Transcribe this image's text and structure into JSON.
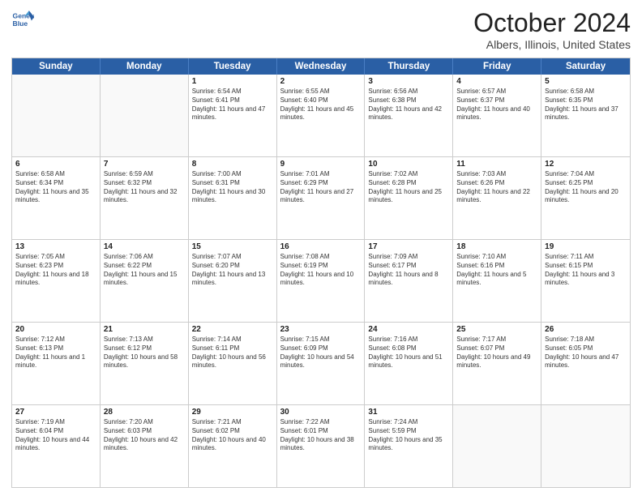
{
  "header": {
    "logo_line1": "General",
    "logo_line2": "Blue",
    "title": "October 2024",
    "subtitle": "Albers, Illinois, United States"
  },
  "days_of_week": [
    "Sunday",
    "Monday",
    "Tuesday",
    "Wednesday",
    "Thursday",
    "Friday",
    "Saturday"
  ],
  "weeks": [
    [
      {
        "day": "",
        "sunrise": "",
        "sunset": "",
        "daylight": "",
        "empty": true
      },
      {
        "day": "",
        "sunrise": "",
        "sunset": "",
        "daylight": "",
        "empty": true
      },
      {
        "day": "1",
        "sunrise": "Sunrise: 6:54 AM",
        "sunset": "Sunset: 6:41 PM",
        "daylight": "Daylight: 11 hours and 47 minutes.",
        "empty": false
      },
      {
        "day": "2",
        "sunrise": "Sunrise: 6:55 AM",
        "sunset": "Sunset: 6:40 PM",
        "daylight": "Daylight: 11 hours and 45 minutes.",
        "empty": false
      },
      {
        "day": "3",
        "sunrise": "Sunrise: 6:56 AM",
        "sunset": "Sunset: 6:38 PM",
        "daylight": "Daylight: 11 hours and 42 minutes.",
        "empty": false
      },
      {
        "day": "4",
        "sunrise": "Sunrise: 6:57 AM",
        "sunset": "Sunset: 6:37 PM",
        "daylight": "Daylight: 11 hours and 40 minutes.",
        "empty": false
      },
      {
        "day": "5",
        "sunrise": "Sunrise: 6:58 AM",
        "sunset": "Sunset: 6:35 PM",
        "daylight": "Daylight: 11 hours and 37 minutes.",
        "empty": false
      }
    ],
    [
      {
        "day": "6",
        "sunrise": "Sunrise: 6:58 AM",
        "sunset": "Sunset: 6:34 PM",
        "daylight": "Daylight: 11 hours and 35 minutes.",
        "empty": false
      },
      {
        "day": "7",
        "sunrise": "Sunrise: 6:59 AM",
        "sunset": "Sunset: 6:32 PM",
        "daylight": "Daylight: 11 hours and 32 minutes.",
        "empty": false
      },
      {
        "day": "8",
        "sunrise": "Sunrise: 7:00 AM",
        "sunset": "Sunset: 6:31 PM",
        "daylight": "Daylight: 11 hours and 30 minutes.",
        "empty": false
      },
      {
        "day": "9",
        "sunrise": "Sunrise: 7:01 AM",
        "sunset": "Sunset: 6:29 PM",
        "daylight": "Daylight: 11 hours and 27 minutes.",
        "empty": false
      },
      {
        "day": "10",
        "sunrise": "Sunrise: 7:02 AM",
        "sunset": "Sunset: 6:28 PM",
        "daylight": "Daylight: 11 hours and 25 minutes.",
        "empty": false
      },
      {
        "day": "11",
        "sunrise": "Sunrise: 7:03 AM",
        "sunset": "Sunset: 6:26 PM",
        "daylight": "Daylight: 11 hours and 22 minutes.",
        "empty": false
      },
      {
        "day": "12",
        "sunrise": "Sunrise: 7:04 AM",
        "sunset": "Sunset: 6:25 PM",
        "daylight": "Daylight: 11 hours and 20 minutes.",
        "empty": false
      }
    ],
    [
      {
        "day": "13",
        "sunrise": "Sunrise: 7:05 AM",
        "sunset": "Sunset: 6:23 PM",
        "daylight": "Daylight: 11 hours and 18 minutes.",
        "empty": false
      },
      {
        "day": "14",
        "sunrise": "Sunrise: 7:06 AM",
        "sunset": "Sunset: 6:22 PM",
        "daylight": "Daylight: 11 hours and 15 minutes.",
        "empty": false
      },
      {
        "day": "15",
        "sunrise": "Sunrise: 7:07 AM",
        "sunset": "Sunset: 6:20 PM",
        "daylight": "Daylight: 11 hours and 13 minutes.",
        "empty": false
      },
      {
        "day": "16",
        "sunrise": "Sunrise: 7:08 AM",
        "sunset": "Sunset: 6:19 PM",
        "daylight": "Daylight: 11 hours and 10 minutes.",
        "empty": false
      },
      {
        "day": "17",
        "sunrise": "Sunrise: 7:09 AM",
        "sunset": "Sunset: 6:17 PM",
        "daylight": "Daylight: 11 hours and 8 minutes.",
        "empty": false
      },
      {
        "day": "18",
        "sunrise": "Sunrise: 7:10 AM",
        "sunset": "Sunset: 6:16 PM",
        "daylight": "Daylight: 11 hours and 5 minutes.",
        "empty": false
      },
      {
        "day": "19",
        "sunrise": "Sunrise: 7:11 AM",
        "sunset": "Sunset: 6:15 PM",
        "daylight": "Daylight: 11 hours and 3 minutes.",
        "empty": false
      }
    ],
    [
      {
        "day": "20",
        "sunrise": "Sunrise: 7:12 AM",
        "sunset": "Sunset: 6:13 PM",
        "daylight": "Daylight: 11 hours and 1 minute.",
        "empty": false
      },
      {
        "day": "21",
        "sunrise": "Sunrise: 7:13 AM",
        "sunset": "Sunset: 6:12 PM",
        "daylight": "Daylight: 10 hours and 58 minutes.",
        "empty": false
      },
      {
        "day": "22",
        "sunrise": "Sunrise: 7:14 AM",
        "sunset": "Sunset: 6:11 PM",
        "daylight": "Daylight: 10 hours and 56 minutes.",
        "empty": false
      },
      {
        "day": "23",
        "sunrise": "Sunrise: 7:15 AM",
        "sunset": "Sunset: 6:09 PM",
        "daylight": "Daylight: 10 hours and 54 minutes.",
        "empty": false
      },
      {
        "day": "24",
        "sunrise": "Sunrise: 7:16 AM",
        "sunset": "Sunset: 6:08 PM",
        "daylight": "Daylight: 10 hours and 51 minutes.",
        "empty": false
      },
      {
        "day": "25",
        "sunrise": "Sunrise: 7:17 AM",
        "sunset": "Sunset: 6:07 PM",
        "daylight": "Daylight: 10 hours and 49 minutes.",
        "empty": false
      },
      {
        "day": "26",
        "sunrise": "Sunrise: 7:18 AM",
        "sunset": "Sunset: 6:05 PM",
        "daylight": "Daylight: 10 hours and 47 minutes.",
        "empty": false
      }
    ],
    [
      {
        "day": "27",
        "sunrise": "Sunrise: 7:19 AM",
        "sunset": "Sunset: 6:04 PM",
        "daylight": "Daylight: 10 hours and 44 minutes.",
        "empty": false
      },
      {
        "day": "28",
        "sunrise": "Sunrise: 7:20 AM",
        "sunset": "Sunset: 6:03 PM",
        "daylight": "Daylight: 10 hours and 42 minutes.",
        "empty": false
      },
      {
        "day": "29",
        "sunrise": "Sunrise: 7:21 AM",
        "sunset": "Sunset: 6:02 PM",
        "daylight": "Daylight: 10 hours and 40 minutes.",
        "empty": false
      },
      {
        "day": "30",
        "sunrise": "Sunrise: 7:22 AM",
        "sunset": "Sunset: 6:01 PM",
        "daylight": "Daylight: 10 hours and 38 minutes.",
        "empty": false
      },
      {
        "day": "31",
        "sunrise": "Sunrise: 7:24 AM",
        "sunset": "Sunset: 5:59 PM",
        "daylight": "Daylight: 10 hours and 35 minutes.",
        "empty": false
      },
      {
        "day": "",
        "sunrise": "",
        "sunset": "",
        "daylight": "",
        "empty": true
      },
      {
        "day": "",
        "sunrise": "",
        "sunset": "",
        "daylight": "",
        "empty": true
      }
    ]
  ]
}
